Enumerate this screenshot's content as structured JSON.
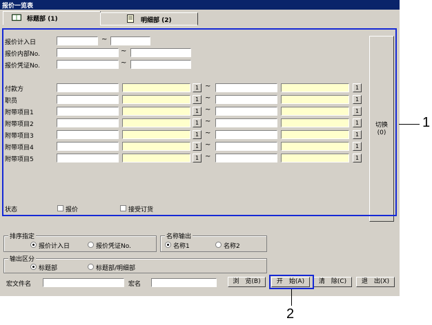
{
  "window": {
    "title": "报价一览表"
  },
  "tabs": [
    {
      "label": "标题部 (1)",
      "icon": "book-icon"
    },
    {
      "label": "明细部 (2)",
      "icon": "document-icon"
    }
  ],
  "header_fields": {
    "date_label": "报价计入日",
    "internal_no_label": "报价内部No.",
    "voucher_no_label": "报价凭证No.",
    "range_sep": "~"
  },
  "detail_rows": [
    {
      "label": "付款方"
    },
    {
      "label": "职员"
    },
    {
      "label": "附带项目1"
    },
    {
      "label": "附带项目2"
    },
    {
      "label": "附带项目3"
    },
    {
      "label": "附带项目4"
    },
    {
      "label": "附带项目5"
    }
  ],
  "small_button_label": "1",
  "switch_button": {
    "line1": "切换",
    "line2": "(0)"
  },
  "status": {
    "label": "状态",
    "opt1": "报价",
    "opt2": "接受订货"
  },
  "sort_group": {
    "caption": "排序指定",
    "opt1": "报价计入日",
    "opt2": "报价凭证No."
  },
  "name_group": {
    "caption": "名称输出",
    "opt1": "名称1",
    "opt2": "名称2"
  },
  "output_group": {
    "caption": "输出区分",
    "opt1": "标题部",
    "opt2": "标题部/明细部"
  },
  "bottom": {
    "macro_file_label": "宏文件名",
    "macro_name_label": "宏名",
    "browse": "浏　览(B)",
    "start": "开　始(A)",
    "clear": "清　除(C)",
    "exit": "退　出(X)"
  },
  "callouts": {
    "c1": "1",
    "c2": "2"
  },
  "colors": {
    "highlight": "#1428d6",
    "titlebar": "#0a246a",
    "input_yellow": "#ffffcc"
  }
}
